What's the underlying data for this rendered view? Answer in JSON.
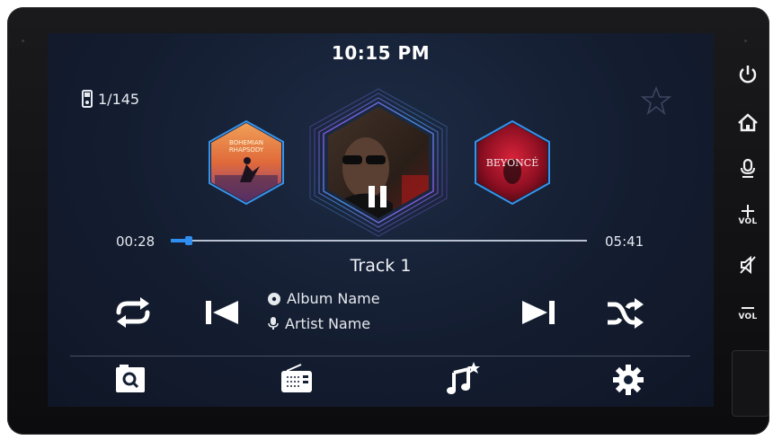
{
  "status": {
    "clock": "10:15 PM",
    "source_count": "1/145"
  },
  "player": {
    "track_title": "Track 1",
    "album_name": "Album Name",
    "artist_name": "Artist Name",
    "elapsed": "00:28",
    "duration": "05:41",
    "progress_fraction": 0.082,
    "state": "paused"
  },
  "albums": [
    {
      "caption": "BOHEMIAN RHAPSODY",
      "role": "previous"
    },
    {
      "caption": "",
      "role": "current"
    },
    {
      "caption": "BEYONCÉ",
      "role": "next"
    }
  ],
  "controls": [
    "repeat-icon",
    "previous-track-icon",
    "next-track-icon",
    "shuffle-icon"
  ],
  "bottom_nav": [
    "search-icon",
    "radio-icon",
    "music-favorites-icon",
    "settings-icon"
  ],
  "side_buttons": {
    "power": "power-icon",
    "home": "home-icon",
    "voice": "microphone-icon",
    "vol_up_label": "VOL",
    "mute": "mute-icon",
    "vol_down_label": "VOL"
  },
  "colors": {
    "accent": "#2f8ff0",
    "hex_glow": "#4aa3ff",
    "hex_glow_alt": "#b44cff"
  }
}
